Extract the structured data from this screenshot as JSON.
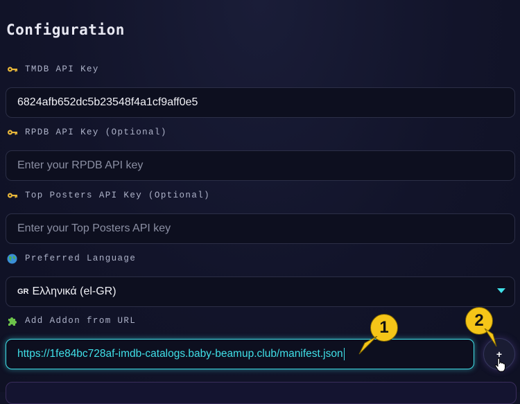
{
  "page": {
    "title": "Configuration"
  },
  "fields": {
    "tmdb": {
      "label": "TMDB API Key",
      "icon": "key-icon",
      "value": "6824afb652dc5b23548f4a1cf9aff0e5"
    },
    "rpdb": {
      "label": "RPDB API Key (Optional)",
      "icon": "key-icon",
      "placeholder": "Enter your RPDB API key"
    },
    "top_posters": {
      "label": "Top Posters API Key (Optional)",
      "icon": "key-icon",
      "placeholder": "Enter your Top Posters API key"
    },
    "language": {
      "label": "Preferred Language",
      "icon": "globe-icon",
      "flag": "GR",
      "value": "Ελληνικά (el-GR)"
    },
    "addon": {
      "label": "Add Addon from URL",
      "icon": "puzzle-icon",
      "value": "https://1fe84bc728af-imdb-catalogs.baby-beamup.club/manifest.json",
      "button_label": "+"
    }
  },
  "annotations": {
    "badge1": "1",
    "badge2": "2",
    "color": "#f5c518"
  },
  "colors": {
    "accent": "#40e0e8",
    "background": "#12142a"
  }
}
